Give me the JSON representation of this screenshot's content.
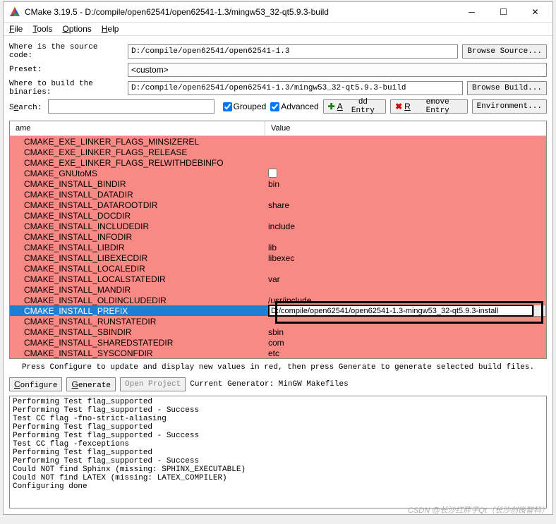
{
  "title": "CMake 3.19.5 - D:/compile/open62541/open62541-1.3/mingw53_32-qt5.9.3-build",
  "menu": {
    "file": "File",
    "tools": "Tools",
    "options": "Options",
    "help": "Help"
  },
  "labels": {
    "source": "Where is the source code:",
    "preset": "Preset:",
    "build": "Where to build the binaries:",
    "search": "Search:"
  },
  "inputs": {
    "source": "D:/compile/open62541/open62541-1.3",
    "preset": "<custom>",
    "build": "D:/compile/open62541/open62541-1.3/mingw53_32-qt5.9.3-build",
    "search": ""
  },
  "buttons": {
    "browse_source": "Browse Source...",
    "browse_build": "Browse Build...",
    "add_entry": "Add Entry",
    "remove_entry": "Remove Entry",
    "environment": "Environment...",
    "configure": "Configure",
    "generate": "Generate",
    "open_project": "Open Project"
  },
  "checks": {
    "grouped": "Grouped",
    "advanced": "Advanced"
  },
  "columns": {
    "name": "ame",
    "value": "Value"
  },
  "rows": [
    {
      "name": "CMAKE_EXE_LINKER_FLAGS_MINSIZEREL",
      "value": "",
      "type": "text"
    },
    {
      "name": "CMAKE_EXE_LINKER_FLAGS_RELEASE",
      "value": "",
      "type": "text"
    },
    {
      "name": "CMAKE_EXE_LINKER_FLAGS_RELWITHDEBINFO",
      "value": "",
      "type": "text"
    },
    {
      "name": "CMAKE_GNUtoMS",
      "value": "",
      "type": "check"
    },
    {
      "name": "CMAKE_INSTALL_BINDIR",
      "value": "bin",
      "type": "text"
    },
    {
      "name": "CMAKE_INSTALL_DATADIR",
      "value": "",
      "type": "text"
    },
    {
      "name": "CMAKE_INSTALL_DATAROOTDIR",
      "value": "share",
      "type": "text"
    },
    {
      "name": "CMAKE_INSTALL_DOCDIR",
      "value": "",
      "type": "text"
    },
    {
      "name": "CMAKE_INSTALL_INCLUDEDIR",
      "value": "include",
      "type": "text"
    },
    {
      "name": "CMAKE_INSTALL_INFODIR",
      "value": "",
      "type": "text"
    },
    {
      "name": "CMAKE_INSTALL_LIBDIR",
      "value": "lib",
      "type": "text"
    },
    {
      "name": "CMAKE_INSTALL_LIBEXECDIR",
      "value": "libexec",
      "type": "text"
    },
    {
      "name": "CMAKE_INSTALL_LOCALEDIR",
      "value": "",
      "type": "text"
    },
    {
      "name": "CMAKE_INSTALL_LOCALSTATEDIR",
      "value": "var",
      "type": "text"
    },
    {
      "name": "CMAKE_INSTALL_MANDIR",
      "value": "",
      "type": "text"
    },
    {
      "name": "CMAKE_INSTALL_OLDINCLUDEDIR",
      "value": "/usr/include",
      "type": "text"
    },
    {
      "name": "CMAKE_INSTALL_PREFIX",
      "value": "D:/compile/open62541/open62541-1.3-mingw53_32-qt5.9.3-install",
      "type": "edit",
      "selected": true
    },
    {
      "name": "CMAKE_INSTALL_RUNSTATEDIR",
      "value": "",
      "type": "text"
    },
    {
      "name": "CMAKE_INSTALL_SBINDIR",
      "value": "sbin",
      "type": "text"
    },
    {
      "name": "CMAKE_INSTALL_SHAREDSTATEDIR",
      "value": "com",
      "type": "text"
    },
    {
      "name": "CMAKE_INSTALL_SYSCONFDIR",
      "value": "etc",
      "type": "text"
    }
  ],
  "hint": "Press Configure to update and display new values in red, then press Generate to generate selected build files.",
  "generator_label": "Current Generator: MinGW Makefiles",
  "output": "Performing Test flag_supported\nPerforming Test flag_supported - Success\nTest CC flag -fno-strict-aliasing\nPerforming Test flag_supported\nPerforming Test flag_supported - Success\nTest CC flag -fexceptions\nPerforming Test flag_supported\nPerforming Test flag_supported - Success\nCould NOT find Sphinx (missing: SPHINX_EXECUTABLE)\nCould NOT find LATEX (missing: LATEX_COMPILER)\nConfiguring done",
  "watermark": "CSDN @长沙红胖子Qt（长沙创微智科）"
}
